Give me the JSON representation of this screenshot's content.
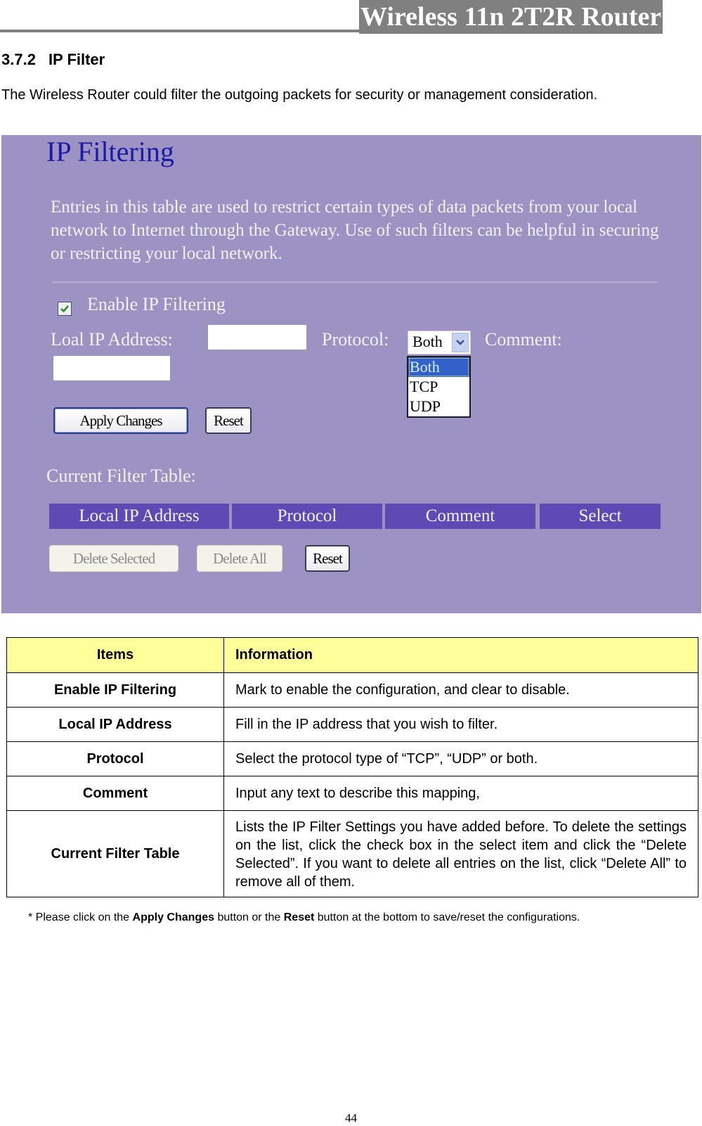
{
  "header": {
    "title": "Wireless 11n 2T2R Router"
  },
  "section": {
    "number": "3.7.2",
    "title": "IP Filter",
    "intro": "The Wireless Router could filter the outgoing packets for security or management consideration."
  },
  "screenshot": {
    "title": "IP Filtering",
    "description": "Entries in this table are used to restrict certain types of data packets from your local network to Internet through the Gateway. Use of such filters can be helpful in securing or restricting your local network.",
    "enable_label": "Enable IP Filtering",
    "enable_checked": true,
    "local_ip_label": "Loal IP Address:",
    "local_ip_value": "",
    "protocol_label": "Protocol:",
    "protocol_selected": "Both",
    "protocol_options": [
      "Both",
      "TCP",
      "UDP"
    ],
    "comment_label": "Comment:",
    "comment_value": "",
    "apply_button": "Apply Changes",
    "reset_button": "Reset",
    "filter_table_label": "Current Filter Table:",
    "filter_table_columns": [
      "Local IP Address",
      "Protocol",
      "Comment",
      "Select"
    ],
    "delete_selected_button": "Delete Selected",
    "delete_all_button": "Delete All",
    "table_reset_button": "Reset",
    "colors": {
      "background": "#9c93c3",
      "title": "#1a1aa6",
      "table_header": "#5d4ab3"
    }
  },
  "info_table": {
    "headers": [
      "Items",
      "Information"
    ],
    "rows": [
      {
        "item": "Enable IP Filtering",
        "info": "Mark to enable the configuration, and clear to disable."
      },
      {
        "item": "Local IP Address",
        "info": "Fill in the IP address that you wish to filter."
      },
      {
        "item": "Protocol",
        "info": "Select the protocol type of “TCP”, “UDP” or both."
      },
      {
        "item": "Comment",
        "info": "Input any text to describe this mapping,"
      },
      {
        "item": "Current Filter Table",
        "info": "Lists the IP Filter Settings you have added before. To delete the settings on the list, click the check box in the select item and click the “Delete Selected”. If you want to delete all entries on the list, click “Delete All” to remove all of them."
      }
    ],
    "header_color": "#ffff99"
  },
  "note": {
    "prefix": "* Please click on the ",
    "apply": "Apply Changes",
    "middle": " button or the ",
    "reset": "Reset",
    "suffix": " button at the bottom to save/reset the configurations."
  },
  "page_number": "44"
}
